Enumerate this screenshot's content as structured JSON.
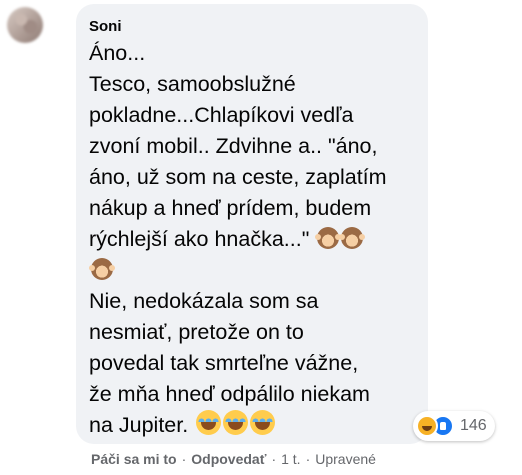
{
  "comment": {
    "author": "Soni",
    "paragraph1": "Áno...\nTesco, samoobslužné\npokladne...Chlapíkovi vedľa\nzvoní mobil.. Zdvihne a.. \"áno,\náno, už som na ceste, zaplatím\nnákup a hneď prídem, budem\nrýchlejší ako hnačka...\"",
    "emoji_line1": [
      "see-no-evil-monkey",
      "see-no-evil-monkey"
    ],
    "emoji_line2": [
      "see-no-evil-monkey"
    ],
    "paragraph2": "Nie, nedokázala som sa\nnesmiať, pretože on to\npovedal tak smrteľne vážne,\nže mňa hneď odpálilo niekam\nna Jupiter.",
    "emoji_end": [
      "face-with-tears-of-joy",
      "face-with-tears-of-joy",
      "face-with-tears-of-joy"
    ]
  },
  "reactions": {
    "icons": [
      "haha-reaction",
      "like-reaction"
    ],
    "count": "146"
  },
  "actions": {
    "like": "Páči sa mi to",
    "reply": "Odpovedať",
    "time": "1 t.",
    "edited": "Upravené",
    "separator": "·"
  },
  "colors": {
    "bubble": "#f0f2f5",
    "text": "#050505",
    "meta": "#65676b",
    "like_blue": "#1877f2",
    "haha_yellow": "#f7b125"
  }
}
